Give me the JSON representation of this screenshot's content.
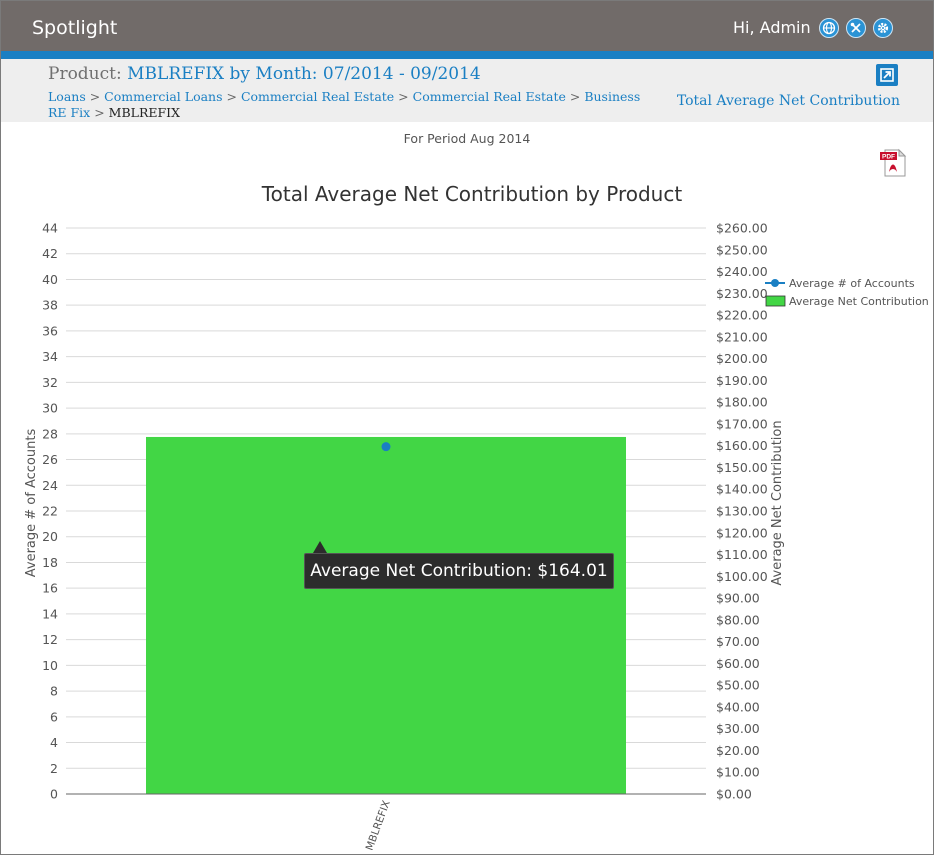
{
  "app": {
    "title": "Spotlight",
    "greeting": "Hi, Admin"
  },
  "topbar_icons": [
    "globe-icon",
    "tools-icon",
    "gear-icon"
  ],
  "header": {
    "product_prefix": "Product: ",
    "product_value": "MBLREFIX by Month: 07/2014 - 09/2014",
    "breadcrumb": [
      {
        "label": "Loans",
        "link": true
      },
      {
        "label": "Commercial Loans",
        "link": true
      },
      {
        "label": "Commercial Real Estate",
        "link": true
      },
      {
        "label": "Commercial Real Estate",
        "link": true
      },
      {
        "label": "Business RE Fix",
        "link": true
      },
      {
        "label": "MBLREFIX",
        "link": false
      }
    ],
    "separator": ">",
    "right_title": "Total Average Net Contribution"
  },
  "period": "For Period Aug 2014",
  "pdf_badge": "PDF",
  "tooltip": {
    "text": "Average Net Contribution: $164.01"
  },
  "colors": {
    "topbar": "#716b69",
    "accent": "#1a7fc3",
    "bar": "#42d645",
    "point": "#1a7fc3"
  },
  "chart_data": {
    "type": "bar",
    "title": "Total Average Net Contribution by Product",
    "categories": [
      "MBLREFIX"
    ],
    "series": [
      {
        "name": "Average Net Contribution",
        "type": "bar",
        "axis": "right",
        "values": [
          164.01
        ]
      },
      {
        "name": "Average # of Accounts",
        "type": "line",
        "axis": "left",
        "values": [
          27
        ]
      }
    ],
    "left_axis": {
      "label": "Average # of Accounts",
      "min": 0,
      "max": 44,
      "step": 2
    },
    "right_axis": {
      "label": "Average Net Contribution",
      "min": 0,
      "max": 260,
      "step": 10,
      "prefix": "$",
      "decimals": 2
    },
    "grid": true,
    "legend": "right"
  }
}
